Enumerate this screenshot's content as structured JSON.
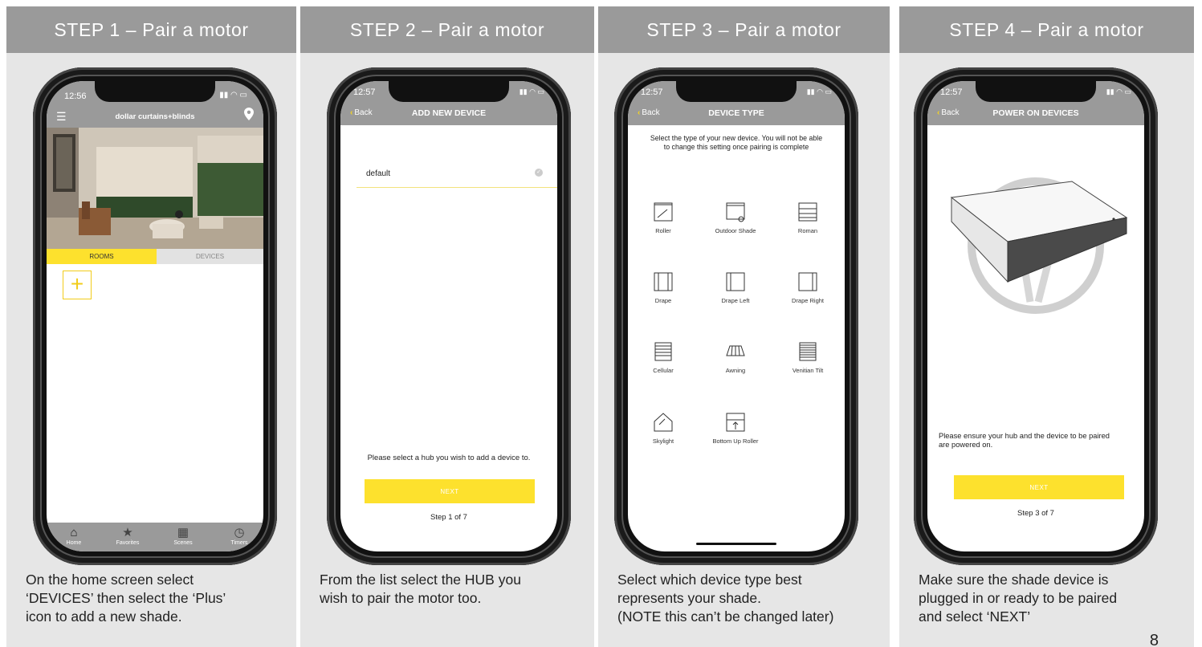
{
  "panels": [
    {
      "heading": "STEP 1 – Pair a motor",
      "caption": "On the home screen select\n‘DEVICES’ then select the ‘Plus’\nicon to add a new shade."
    },
    {
      "heading": "STEP 2 – Pair a motor",
      "caption": "From the list select the HUB you\nwish to pair the motor too."
    },
    {
      "heading": "STEP 3 – Pair a motor",
      "caption": "Select which device type best\nrepresents your shade.\n(NOTE this can’t be changed later)"
    },
    {
      "heading": "STEP 4 – Pair a motor",
      "caption": "Make sure the shade device is\nplugged in or ready to be paired\nand select ‘NEXT’"
    }
  ],
  "step1": {
    "time": "12:56",
    "brand": "dollar curtains+blinds",
    "tabs": [
      "ROOMS",
      "DEVICES"
    ],
    "add_symbol": "+",
    "bottom_tabs": [
      {
        "label": "Home",
        "icon": "home-icon"
      },
      {
        "label": "Favorites",
        "icon": "star-icon"
      },
      {
        "label": "Scenes",
        "icon": "film-icon"
      },
      {
        "label": "Timers",
        "icon": "clock-icon"
      }
    ]
  },
  "step2": {
    "time": "12:57",
    "back": "Back",
    "title": "ADD NEW DEVICE",
    "hub_item": "default",
    "prompt": "Please select a hub you wish to add a device to.",
    "next": "NEXT",
    "step": "Step 1 of 7"
  },
  "step3": {
    "time": "12:57",
    "back": "Back",
    "title": "DEVICE TYPE",
    "instruction_1": "Select the type of your new device. You will not be able",
    "instruction_2": "to change this setting once pairing is complete",
    "devices": [
      "Roller",
      "Outdoor Shade",
      "Roman",
      "Drape",
      "Drape Left",
      "Drape Right",
      "Cellular",
      "Awning",
      "Venitian Tilt",
      "Skylight",
      "Bottom Up Roller"
    ]
  },
  "step4": {
    "time": "12:57",
    "back": "Back",
    "title": "POWER ON DEVICES",
    "prompt_1": "Please ensure your hub and the device to be paired",
    "prompt_2": "are powered on.",
    "next": "NEXT",
    "step": "Step 3 of 7"
  },
  "page_number": "8",
  "colors": {
    "accent": "#fde12d",
    "header_gray": "#9a9a9a",
    "panel_bg": "#e6e6e6"
  }
}
